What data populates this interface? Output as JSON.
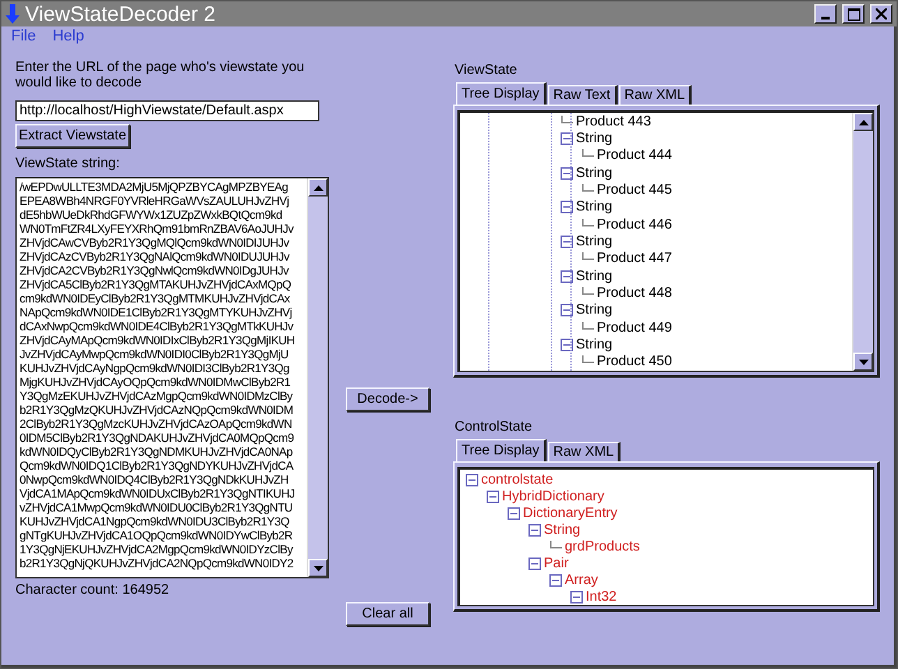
{
  "window": {
    "title": "ViewStateDecoder 2"
  },
  "menu": [
    {
      "label": "File"
    },
    {
      "label": "Help"
    }
  ],
  "url_prompt": "Enter the URL of the page who's viewstate you would like to decode",
  "url_field": {
    "value": "http://localhost/HighViewstate/Default.aspx"
  },
  "extract_button": "Extract Viewstate",
  "viewstate_string_label": "ViewState string:",
  "viewstate_string_lines": [
    "/wEPDwULLTE3MDA2MjU5MjQPZBYCAgMPZBYEAg",
    "EPEA8WBh4NRGF0YVRleHRGaWVsZAULUHJvZHVj",
    "dE5hbWUeDkRhdGFWYWx1ZUZpZWxkBQtQcm9kd",
    "WN0TmFtZR4LXyFEYXRhQm91bmRnZBAV6AoJUHJv",
    "ZHVjdCAwCVByb2R1Y3QgMQlQcm9kdWN0IDIJUHJv",
    "ZHVjdCAzCVByb2R1Y3QgNAlQcm9kdWN0IDUJUHJv",
    "ZHVjdCA2CVByb2R1Y3QgNwlQcm9kdWN0IDgJUHJv",
    "ZHVjdCA5ClByb2R1Y3QgMTAKUHJvZHVjdCAxMQpQ",
    "cm9kdWN0IDEyClByb2R1Y3QgMTMKUHJvZHVjdCAx",
    "NApQcm9kdWN0IDE1ClByb2R1Y3QgMTYKUHJvZHVj",
    "dCAxNwpQcm9kdWN0IDE4ClByb2R1Y3QgMTkKUHJv",
    "ZHVjdCAyMApQcm9kdWN0IDIxClByb2R1Y3QgMjIKUH",
    "JvZHVjdCAyMwpQcm9kdWN0IDI0ClByb2R1Y3QgMjU",
    "KUHJvZHVjdCAyNgpQcm9kdWN0IDI3ClByb2R1Y3Qg",
    "MjgKUHJvZHVjdCAyOQpQcm9kdWN0IDMwClByb2R1",
    "Y3QgMzEKUHJvZHVjdCAzMgpQcm9kdWN0IDMzClBy",
    "b2R1Y3QgMzQKUHJvZHVjdCAzNQpQcm9kdWN0IDM",
    "2ClByb2R1Y3QgMzcKUHJvZHVjdCAzOApQcm9kdWN",
    "0IDM5ClByb2R1Y3QgNDAKUHJvZHVjdCA0MQpQcm9",
    "kdWN0IDQyClByb2R1Y3QgNDMKUHJvZHVjdCA0NAp",
    "Qcm9kdWN0IDQ1ClByb2R1Y3QgNDYKUHJvZHVjdCA",
    "0NwpQcm9kdWN0IDQ4ClByb2R1Y3QgNDkKUHJvZH",
    "VjdCA1MApQcm9kdWN0IDUxClByb2R1Y3QgNTIKUHJ",
    "vZHVjdCA1MwpQcm9kdWN0IDU0ClByb2R1Y3QgNTU",
    "KUHJvZHVjdCA1NgpQcm9kdWN0IDU3ClByb2R1Y3Q",
    "gNTgKUHJvZHVjdCA1OQpQcm9kdWN0IDYwClByb2R",
    "1Y3QgNjEKUHJvZHVjdCA2MgpQcm9kdWN0IDYzClBy",
    "b2R1Y3QgNjQKUHJvZHVjdCA2NQpQcm9kdWN0IDY2"
  ],
  "character_count": "Character count: 164952",
  "decode_button": "Decode->",
  "clear_button": "Clear all",
  "viewstate": {
    "label": "ViewState",
    "tabs": [
      {
        "label": "Tree Display",
        "selected": true
      },
      {
        "label": "Raw Text",
        "selected": false
      },
      {
        "label": "Raw XML",
        "selected": false
      }
    ],
    "tree": [
      {
        "label": "Product 443"
      },
      {
        "label": "String",
        "expanded": true,
        "children": [
          {
            "label": "Product 444"
          }
        ]
      },
      {
        "label": "String",
        "expanded": true,
        "children": [
          {
            "label": "Product 445"
          }
        ]
      },
      {
        "label": "String",
        "expanded": true,
        "children": [
          {
            "label": "Product 446"
          }
        ]
      },
      {
        "label": "String",
        "expanded": true,
        "children": [
          {
            "label": "Product 447"
          }
        ]
      },
      {
        "label": "String",
        "expanded": true,
        "children": [
          {
            "label": "Product 448"
          }
        ]
      },
      {
        "label": "String",
        "expanded": true,
        "children": [
          {
            "label": "Product 449"
          }
        ]
      },
      {
        "label": "String",
        "expanded": true,
        "children": [
          {
            "label": "Product 450"
          }
        ]
      }
    ]
  },
  "controlstate": {
    "label": "ControlState",
    "tabs": [
      {
        "label": "Tree Display",
        "selected": true
      },
      {
        "label": "Raw XML",
        "selected": false
      }
    ],
    "tree": [
      {
        "label": "controlstate",
        "expanded": true,
        "children": [
          {
            "label": "HybridDictionary",
            "expanded": true,
            "children": [
              {
                "label": "DictionaryEntry",
                "expanded": true,
                "children": [
                  {
                    "label": "String",
                    "expanded": true,
                    "children": [
                      {
                        "label": "grdProducts"
                      }
                    ]
                  },
                  {
                    "label": "Pair",
                    "expanded": true,
                    "children": [
                      {
                        "label": "Array",
                        "expanded": true,
                        "children": [
                          {
                            "label": "Int32",
                            "expanded": true
                          }
                        ]
                      }
                    ]
                  }
                ]
              }
            ]
          }
        ]
      }
    ]
  }
}
